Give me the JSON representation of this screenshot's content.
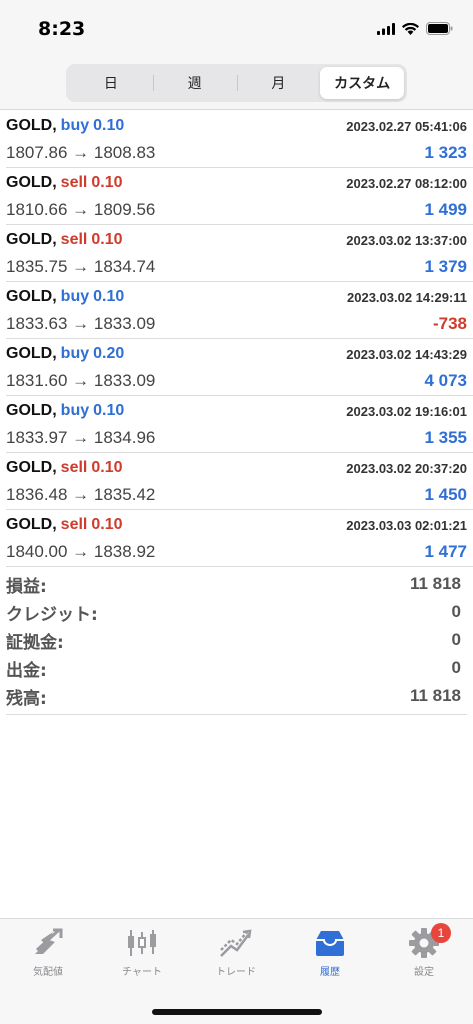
{
  "status": {
    "time": "8:23"
  },
  "segments": [
    {
      "label": "日",
      "active": false
    },
    {
      "label": "週",
      "active": false
    },
    {
      "label": "月",
      "active": false
    },
    {
      "label": "カスタム",
      "active": true
    }
  ],
  "deals": [
    {
      "symbol": "GOLD,",
      "side": "buy",
      "volume": "0.10",
      "time": "2023.02.27 05:41:06",
      "prices": "1807.86 → 1808.83",
      "profit": "1 323",
      "profit_sign": "pos"
    },
    {
      "symbol": "GOLD,",
      "side": "sell",
      "volume": "0.10",
      "time": "2023.02.27 08:12:00",
      "prices": "1810.66 → 1809.56",
      "profit": "1 499",
      "profit_sign": "pos"
    },
    {
      "symbol": "GOLD,",
      "side": "sell",
      "volume": "0.10",
      "time": "2023.03.02 13:37:00",
      "prices": "1835.75 → 1834.74",
      "profit": "1 379",
      "profit_sign": "pos"
    },
    {
      "symbol": "GOLD,",
      "side": "buy",
      "volume": "0.10",
      "time": "2023.03.02 14:29:11",
      "prices": "1833.63 → 1833.09",
      "profit": "-738",
      "profit_sign": "neg"
    },
    {
      "symbol": "GOLD,",
      "side": "buy",
      "volume": "0.20",
      "time": "2023.03.02 14:43:29",
      "prices": "1831.60 → 1833.09",
      "profit": "4 073",
      "profit_sign": "pos"
    },
    {
      "symbol": "GOLD,",
      "side": "buy",
      "volume": "0.10",
      "time": "2023.03.02 19:16:01",
      "prices": "1833.97 → 1834.96",
      "profit": "1 355",
      "profit_sign": "pos"
    },
    {
      "symbol": "GOLD,",
      "side": "sell",
      "volume": "0.10",
      "time": "2023.03.02 20:37:20",
      "prices": "1836.48 → 1835.42",
      "profit": "1 450",
      "profit_sign": "pos"
    },
    {
      "symbol": "GOLD,",
      "side": "sell",
      "volume": "0.10",
      "time": "2023.03.03 02:01:21",
      "prices": "1840.00 → 1838.92",
      "profit": "1 477",
      "profit_sign": "pos"
    }
  ],
  "summary": [
    {
      "label": "損益:",
      "value": "11 818"
    },
    {
      "label": "クレジット:",
      "value": "0"
    },
    {
      "label": "証拠金:",
      "value": "0"
    },
    {
      "label": "出金:",
      "value": "0"
    },
    {
      "label": "残高:",
      "value": "11 818"
    }
  ],
  "tabs": [
    {
      "label": "気配値",
      "icon": "quotes-icon",
      "active": false
    },
    {
      "label": "チャート",
      "icon": "chart-icon",
      "active": false
    },
    {
      "label": "トレード",
      "icon": "trade-icon",
      "active": false
    },
    {
      "label": "履歴",
      "icon": "history-icon",
      "active": true
    },
    {
      "label": "設定",
      "icon": "settings-icon",
      "active": false,
      "badge": "1"
    }
  ],
  "colors": {
    "buy": "#2f6fd6",
    "sell": "#cf3b2c",
    "accent": "#2f6fd6",
    "badge": "#e8453c"
  }
}
